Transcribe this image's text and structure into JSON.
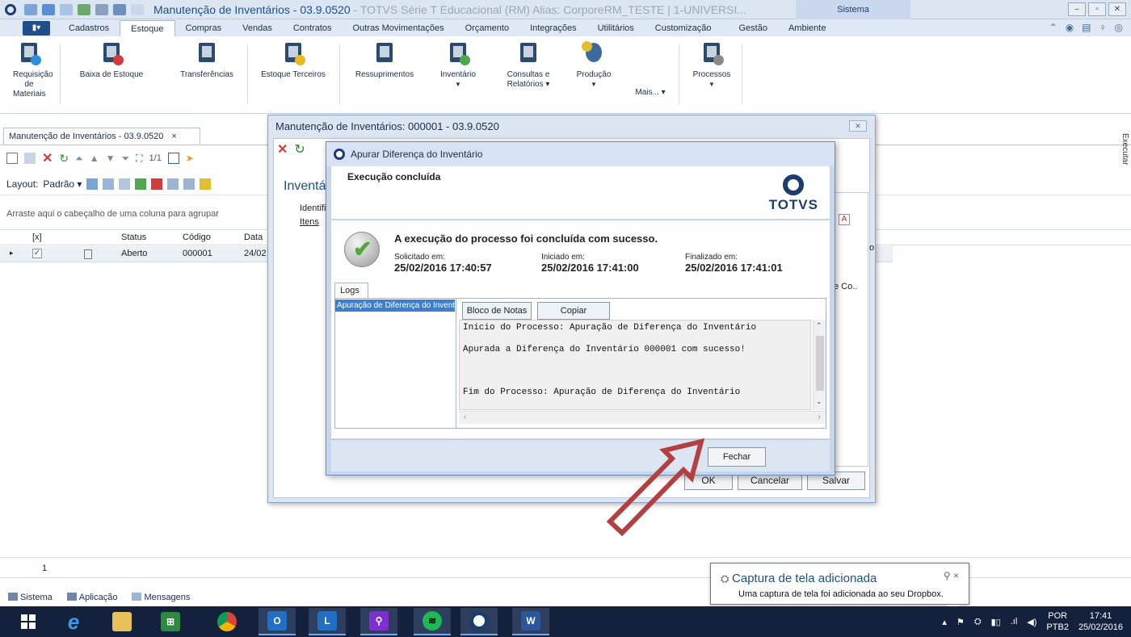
{
  "window": {
    "title": "Manutenção de Inventários - 03.9.0520",
    "title_suffix": " - TOTVS Série T Educacional (RM) Alias: CorporeRM_TESTE | 1-UNIVERSI...",
    "sistema_label": "Sistema"
  },
  "menu": {
    "app_button": "▮▾",
    "tabs": [
      "Cadastros",
      "Estoque",
      "Compras",
      "Vendas",
      "Contratos",
      "Outras Movimentações",
      "Orçamento",
      "Integrações",
      "Utilitários",
      "Customização",
      "Gestão",
      "Ambiente"
    ],
    "active_tab": "Estoque"
  },
  "ribbon": {
    "items": [
      {
        "label": "Requisição\nde Materiais"
      },
      {
        "label": "Baixa de Estoque"
      },
      {
        "label": "Transferências"
      },
      {
        "label": "Estoque Terceiros"
      },
      {
        "label": "Ressuprimentos"
      },
      {
        "label": "Inventário"
      },
      {
        "label": "Consultas e\nRelatórios ▾"
      },
      {
        "label": "Produção"
      },
      {
        "label": "Mais... ▾"
      },
      {
        "label": "Processos"
      }
    ]
  },
  "doc_tab": {
    "label": "Manutenção de Inventários - 03.9.0520",
    "close": "×"
  },
  "toolbar": {
    "pager": "1/1",
    "layout_label": "Layout:",
    "layout_value": "Padrão ▾"
  },
  "grid": {
    "group_hint": "Arraste aqui o cabeçalho de uma coluna para agrupar",
    "headers": {
      "check": "[x]",
      "status": "Status",
      "codigo": "Código",
      "data": "Data"
    },
    "row": {
      "status": "Aberto",
      "codigo": "000001",
      "data": "24/02"
    },
    "page": "1"
  },
  "side_panel": {
    "executar": "Executar"
  },
  "bottom_tabs": [
    "Sistema",
    "Aplicação",
    "Mensagens"
  ],
  "outer_dialog": {
    "title": "Manutenção de Inventários: 000001 - 03.9.0520",
    "heading": "Inventá",
    "label_identifi": "Identifi",
    "label_itens": "Itens",
    "right_cell": "e Co..",
    "right_col": "o",
    "buttons": {
      "ok": "OK",
      "cancelar": "Cancelar",
      "salvar": "Salvar"
    }
  },
  "inner_dialog": {
    "title": "Apurar Diferença do Inventário",
    "status_header": "Execução concluída",
    "logo_text": "TOTVS",
    "success_message": "A execução do processo foi concluída com sucesso.",
    "solicitado_label": "Solicitado em:",
    "solicitado_value": "25/02/2016 17:40:57",
    "iniciado_label": "Iniciado em:",
    "iniciado_value": "25/02/2016 17:41:00",
    "finalizado_label": "Finalizado em:",
    "finalizado_value": "25/02/2016 17:41:01",
    "logs_tab": "Logs",
    "log_item": "Apuração de Diferença do Inventário",
    "bloco_notas": "Bloco de Notas",
    "copiar": "Copiar",
    "log_lines": [
      "Inicio do Processo: Apuração de Diferença do Inventário",
      "Apurada a Diferença do Inventário 000001 com sucesso!",
      "Fim do Processo: Apuração de Diferença do Inventário"
    ],
    "fechar": "Fechar"
  },
  "toast": {
    "title": "Captura de tela adicionada",
    "message": "Uma captura de tela foi adicionada ao seu Dropbox.",
    "close": "× "
  },
  "tray": {
    "lang": "POR",
    "layout": "PTB2",
    "time": "17:41",
    "date": "25/02/2016"
  },
  "colors": {
    "accent": "#1c4f8a",
    "taskbar": "#14213d",
    "arrow": "#b34040"
  }
}
